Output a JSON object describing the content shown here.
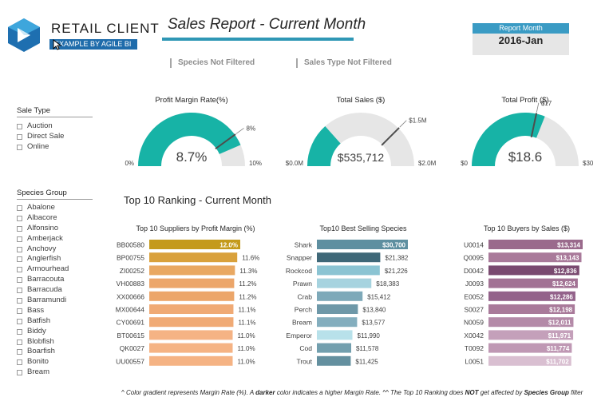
{
  "brand": {
    "name": "RETAIL CLIENT",
    "sub": "EXAMPLE BY AGILE BI"
  },
  "title": "Sales Report - Current Month",
  "report_month": {
    "label": "Report Month",
    "value": "2016-Jan"
  },
  "filters": {
    "species": "Species Not Filtered",
    "sales_type": "Sales Type Not Filtered"
  },
  "slicers": {
    "sale_type": {
      "title": "Sale Type",
      "items": [
        "Auction",
        "Direct Sale",
        "Online"
      ]
    },
    "species_group": {
      "title": "Species Group",
      "items": [
        "Abalone",
        "Albacore",
        "Alfonsino",
        "Amberjack",
        "Anchovy",
        "Anglerfish",
        "Armourhead",
        "Barracouta",
        "Barracuda",
        "Barramundi",
        "Bass",
        "Batfish",
        "Biddy",
        "Blobfish",
        "Boarfish",
        "Bonito",
        "Bream"
      ]
    }
  },
  "colors": {
    "gauge_fill": "#17b3a6",
    "gauge_track": "#e6e6e6",
    "gauge_target": "#4d4d4d",
    "accent": "#2f97b5"
  },
  "ranking_title": "Top 10 Ranking - Current Month",
  "footnote": {
    "p1": "^ Color gradient represents Margin Rate (%). A ",
    "b1": "darker",
    "p2": " color indicates a higher Margin Rate.  ^^ The Top 10 Ranking does ",
    "b2": "NOT",
    "p3": " get affected by ",
    "b3": "Species Group",
    "p4": " filter"
  },
  "chart_data": [
    {
      "type": "gauge",
      "title": "Profit Margin Rate(%)",
      "value": 8.7,
      "value_label": "8.7%",
      "min": 0,
      "min_label": "0%",
      "max": 10,
      "max_label": "10%",
      "target": 8,
      "target_label": "8%"
    },
    {
      "type": "gauge",
      "title": "Total Sales ($)",
      "value": 535712,
      "value_label": "$535,712",
      "min": 0,
      "min_label": "$0.0M",
      "max": 2000000,
      "max_label": "$2.0M",
      "target": 1500000,
      "target_label": "$1.5M"
    },
    {
      "type": "gauge",
      "title": "Total Profit ($)",
      "value": 18.6,
      "value_label": "$18.6",
      "min": 0,
      "min_label": "$0",
      "max": 30,
      "max_label": "$30",
      "target": 17,
      "target_label": "$17"
    },
    {
      "type": "bar",
      "orientation": "horizontal",
      "title": "Top 10 Suppliers by Profit Margin (%)",
      "categories": [
        "BB00580",
        "BP00755",
        "ZI00252",
        "VH00883",
        "XX00666",
        "MX00644",
        "CY00691",
        "BT00615",
        "QK0027",
        "UU00557"
      ],
      "values": [
        12.0,
        11.6,
        11.3,
        11.2,
        11.2,
        11.1,
        11.1,
        11.0,
        11.0,
        11.0
      ],
      "labels": [
        "12.0%",
        "11.6%",
        "11.3%",
        "11.2%",
        "11.2%",
        "11.1%",
        "11.1%",
        "11.0%",
        "11.0%",
        "11.0%"
      ],
      "colors": [
        "#c49a1c",
        "#d9a13c",
        "#e9a862",
        "#eca66a",
        "#eca66a",
        "#f0aa75",
        "#f0aa75",
        "#f5b384",
        "#f5b384",
        "#f5b384"
      ],
      "label_inside_first": true
    },
    {
      "type": "bar",
      "orientation": "horizontal",
      "title": "Top10 Best Selling Species",
      "categories": [
        "Shark",
        "Snapper",
        "Rockcod",
        "Prawn",
        "Crab",
        "Perch",
        "Bream",
        "Emperor",
        "Cod",
        "Trout"
      ],
      "values": [
        30700,
        21382,
        21226,
        18383,
        15412,
        13840,
        13577,
        11990,
        11578,
        11425
      ],
      "labels": [
        "$30,700",
        "$21,382",
        "$21,226",
        "$18,383",
        "$15,412",
        "$13,840",
        "$13,577",
        "$11,990",
        "$11,578",
        "$11,425"
      ],
      "colors": [
        "#5e8fa0",
        "#3f6878",
        "#8bc4d3",
        "#a6d3df",
        "#7ea9b9",
        "#6e98a8",
        "#84aebe",
        "#b8e1ea",
        "#729fae",
        "#64909f"
      ],
      "label_inside_first": true
    },
    {
      "type": "bar",
      "orientation": "horizontal",
      "title": "Top 10 Buyers by Sales ($)",
      "categories": [
        "U0014",
        "Q0095",
        "D0042",
        "J0093",
        "E0052",
        "S0027",
        "N0059",
        "X0042",
        "T0092",
        "L0051"
      ],
      "values": [
        13314,
        13143,
        12836,
        12624,
        12286,
        12198,
        12011,
        11971,
        11774,
        11702
      ],
      "labels": [
        "$13,314",
        "$13,143",
        "$12,836",
        "$12,624",
        "$12,286",
        "$12,198",
        "$12,011",
        "$11,971",
        "$11,774",
        "$11,702"
      ],
      "colors": [
        "#9a6a8c",
        "#a97a9a",
        "#7a4a70",
        "#a27294",
        "#93628a",
        "#a97a9a",
        "#b48aa8",
        "#c4a0ba",
        "#bf98b4",
        "#d9bfd1"
      ],
      "label_inside_all": true
    }
  ]
}
